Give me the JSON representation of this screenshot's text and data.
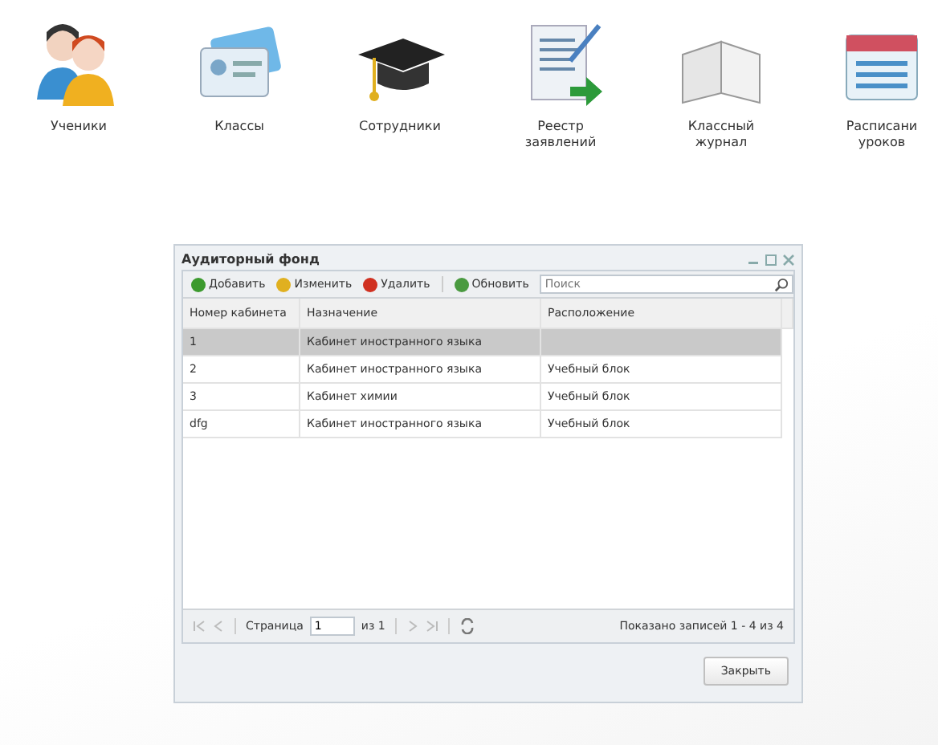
{
  "launcher": [
    {
      "kind": "people",
      "label": "Ученики"
    },
    {
      "kind": "cards",
      "label": "Классы"
    },
    {
      "kind": "cap",
      "label": "Сотрудники"
    },
    {
      "kind": "scroll",
      "label": "Реестр заявлений"
    },
    {
      "kind": "book",
      "label": "Классный журнал"
    },
    {
      "kind": "calendar",
      "label": "Расписани уроков"
    }
  ],
  "window": {
    "title": "Аудиторный фонд",
    "toolbar": [
      {
        "kind": "add",
        "label": "Добавить"
      },
      {
        "kind": "edit",
        "label": "Изменить"
      },
      {
        "kind": "delete",
        "label": "Удалить"
      },
      {
        "kind": "refresh",
        "label": "Обновить"
      }
    ],
    "search": {
      "placeholder": "Поиск"
    },
    "columns": [
      "Номер кабинета",
      "Назначение",
      "Расположение"
    ],
    "rows": [
      {
        "cells": [
          "1",
          "Кабинет иностранного языка",
          ""
        ],
        "selected": true
      },
      {
        "cells": [
          "2",
          "Кабинет иностранного языка",
          "Учебный блок"
        ],
        "selected": false
      },
      {
        "cells": [
          "3",
          "Кабинет химии",
          "Учебный блок"
        ],
        "selected": false
      },
      {
        "cells": [
          "dfg",
          "Кабинет иностранного языка",
          "Учебный блок"
        ],
        "selected": false
      }
    ],
    "pager": {
      "page_label": "Страница",
      "page": "1",
      "of_label": "из 1",
      "summary": "Показано записей 1 - 4 из 4"
    },
    "close_button": "Закрыть"
  }
}
